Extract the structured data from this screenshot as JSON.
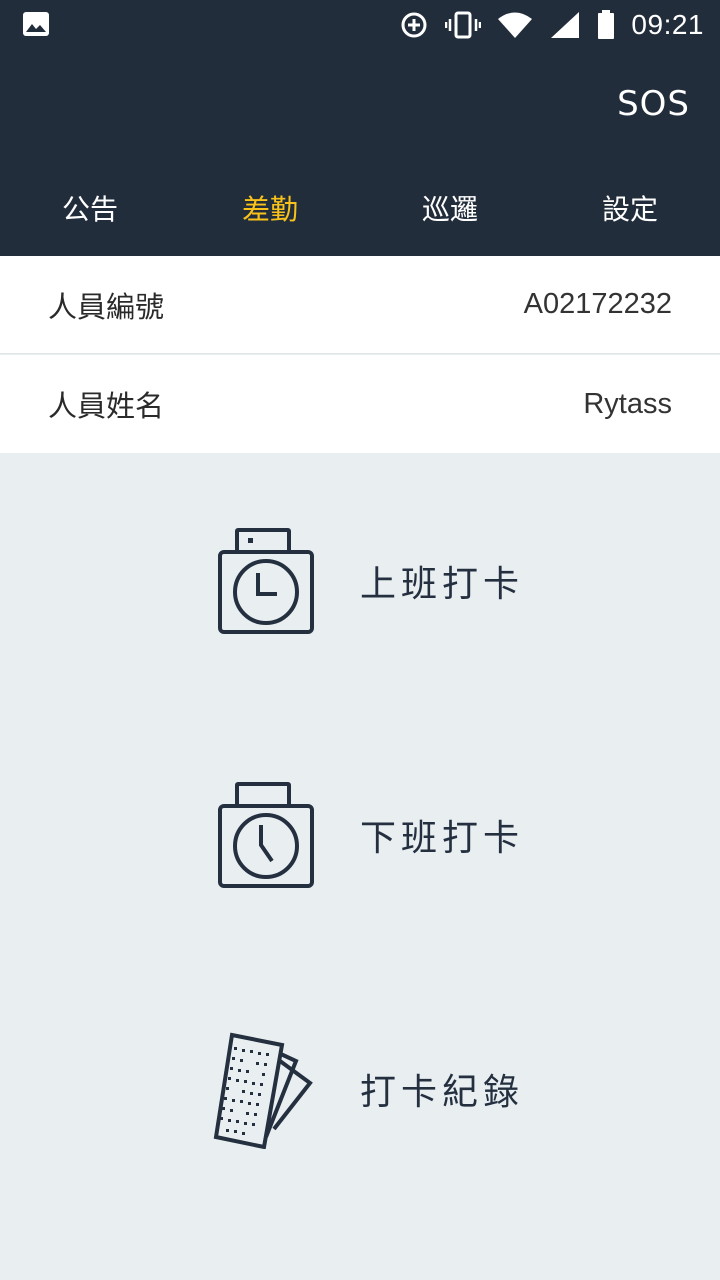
{
  "status_bar": {
    "time": "09:21",
    "icons": [
      "image-icon",
      "data-saver-icon",
      "vibrate-icon",
      "wifi-icon",
      "signal-icon",
      "battery-icon"
    ]
  },
  "header": {
    "sos_label": "SOS",
    "background_color": "#222d3c"
  },
  "tabs": [
    {
      "label": "公告",
      "active": false
    },
    {
      "label": "差勤",
      "active": true
    },
    {
      "label": "巡邏",
      "active": false
    },
    {
      "label": "設定",
      "active": false
    }
  ],
  "accent_color": "#f8c21b",
  "employee": {
    "id_label": "人員編號",
    "id_value": "A02172232",
    "name_label": "人員姓名",
    "name_value": "Rytass"
  },
  "actions": [
    {
      "label": "上班打卡",
      "icon": "clock-in-icon"
    },
    {
      "label": "下班打卡",
      "icon": "clock-out-icon"
    },
    {
      "label": "打卡紀錄",
      "icon": "punch-cards-icon"
    }
  ]
}
